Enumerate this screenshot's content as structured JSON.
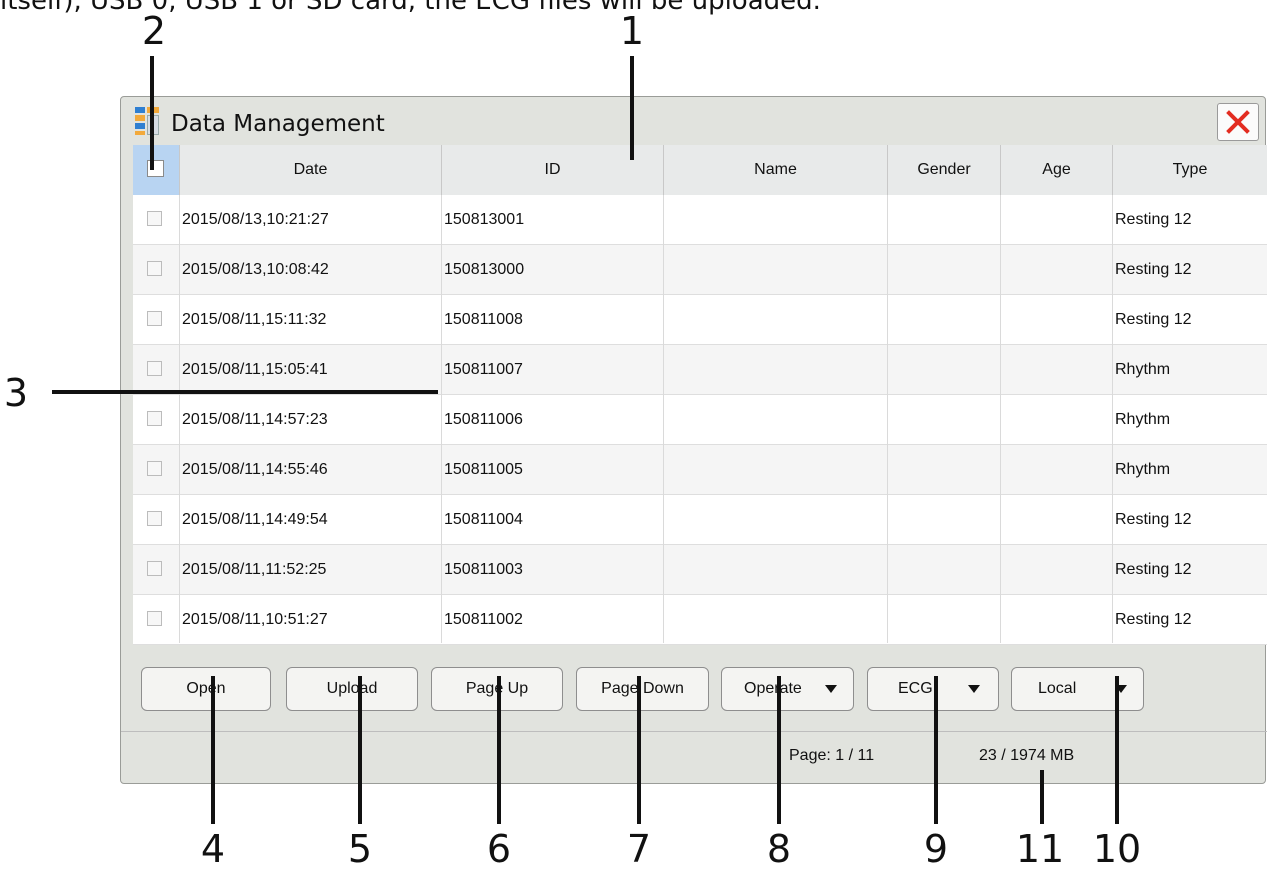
{
  "top_text": "itself), USB 0, USB 1 or SD card, the ECG files will be uploaded.",
  "callouts": [
    "1",
    "2",
    "3",
    "4",
    "5",
    "6",
    "7",
    "8",
    "9",
    "10",
    "11"
  ],
  "window": {
    "title": "Data Management",
    "close_icon": "close-x-icon",
    "colors": {
      "close": "#e32c20",
      "header_check_bg": "#b8d4f2"
    }
  },
  "table": {
    "columns": [
      "Date",
      "ID",
      "Name",
      "Gender",
      "Age",
      "Type"
    ],
    "rows": [
      {
        "date": "2015/08/13,10:21:27",
        "id": "150813001",
        "name": "",
        "gender": "",
        "age": "",
        "type": "Resting 12"
      },
      {
        "date": "2015/08/13,10:08:42",
        "id": "150813000",
        "name": "",
        "gender": "",
        "age": "",
        "type": "Resting 12"
      },
      {
        "date": "2015/08/11,15:11:32",
        "id": "150811008",
        "name": "",
        "gender": "",
        "age": "",
        "type": "Resting 12"
      },
      {
        "date": "2015/08/11,15:05:41",
        "id": "150811007",
        "name": "",
        "gender": "",
        "age": "",
        "type": "Rhythm"
      },
      {
        "date": "2015/08/11,14:57:23",
        "id": "150811006",
        "name": "",
        "gender": "",
        "age": "",
        "type": "Rhythm"
      },
      {
        "date": "2015/08/11,14:55:46",
        "id": "150811005",
        "name": "",
        "gender": "",
        "age": "",
        "type": "Rhythm"
      },
      {
        "date": "2015/08/11,14:49:54",
        "id": "150811004",
        "name": "",
        "gender": "",
        "age": "",
        "type": "Resting 12"
      },
      {
        "date": "2015/08/11,11:52:25",
        "id": "150811003",
        "name": "",
        "gender": "",
        "age": "",
        "type": "Resting 12"
      },
      {
        "date": "2015/08/11,10:51:27",
        "id": "150811002",
        "name": "",
        "gender": "",
        "age": "",
        "type": "Resting 12"
      }
    ]
  },
  "buttons": {
    "open": "Open",
    "upload": "Upload",
    "page_up": "Page Up",
    "page_down": "Page Down",
    "operate": "Operate",
    "ecg": "ECG",
    "local": "Local"
  },
  "status": {
    "page": "Page: 1 / 11",
    "storage": "23 / 1974 MB"
  }
}
